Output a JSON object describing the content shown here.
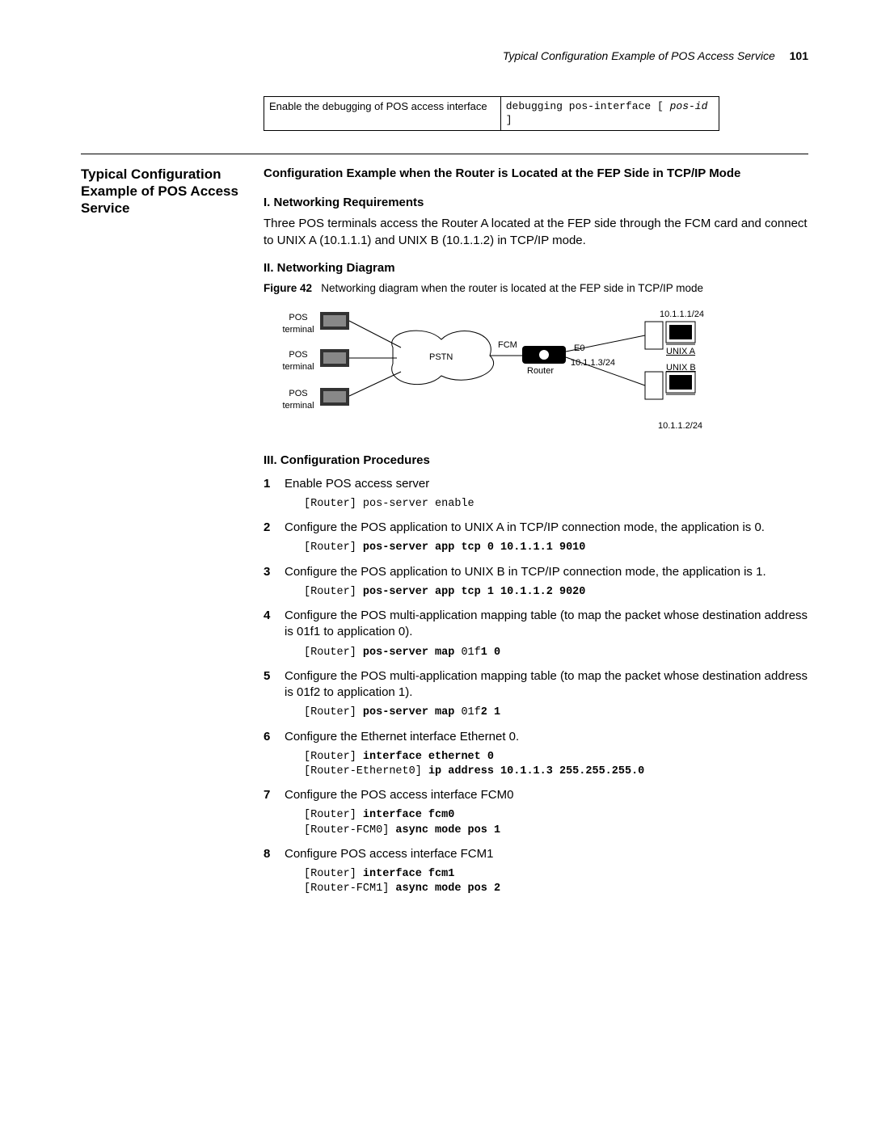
{
  "running_head": {
    "title": "Typical Configuration Example of POS Access Service",
    "page": "101"
  },
  "table": {
    "desc": "Enable the debugging of POS access interface",
    "cmd_lead": "debugging pos-interface [ ",
    "cmd_arg": "pos-id",
    "cmd_trail": " ]"
  },
  "side_head": "Typical Configuration Example of POS Access Service",
  "sec_title": "Configuration Example when the Router is Located at the FEP Side in TCP/IP Mode",
  "h_req": "I. Networking Requirements",
  "req_body": "Three POS terminals access the Router A located at the FEP side through the FCM card and connect to UNIX A (10.1.1.1) and UNIX B (10.1.1.2) in TCP/IP mode.",
  "h_diag": "II. Networking Diagram",
  "figcap_lead": "Figure 42",
  "figcap_body": "Networking diagram when the router is located at the FEP side in TCP/IP mode",
  "diagram": {
    "pos1": "POS terminal",
    "pos2": "POS terminal",
    "pos3": "POS terminal",
    "pstn": "PSTN",
    "fcm": "FCM",
    "router": "Router",
    "e0": "E0",
    "e0_ip": "10.1.1.3/24",
    "unix_a": "UNIX A",
    "unix_a_ip": "10.1.1.1/24",
    "unix_b": "UNIX B",
    "unix_b_ip": "10.1.1.2/24"
  },
  "h_proc": "III. Configuration Procedures",
  "steps": {
    "s1": {
      "text": "Enable POS access server",
      "code": "[Router] pos-server enable"
    },
    "s2": {
      "text": "Configure the POS application to UNIX A in TCP/IP connection mode, the application is 0.",
      "code_pre": "[Router] ",
      "code_b": "pos-server app tcp 0 10.1.1.1 9010"
    },
    "s3": {
      "text": "Configure the POS application to UNIX B in TCP/IP connection mode, the application is 1.",
      "code_pre": "[Router] ",
      "code_b": "pos-server app tcp 1 10.1.1.2 9020"
    },
    "s4": {
      "text": "Configure the POS multi-application mapping table (to map the packet whose destination address is 01f1 to application 0).",
      "code_pre": "[Router] ",
      "code_b": "pos-server map ",
      "code_n": "01f",
      "code_b2": "1 0"
    },
    "s5": {
      "text": "Configure the POS multi-application mapping table (to map the packet whose destination address is 01f2 to application 1).",
      "code_pre": "[Router] ",
      "code_b": "pos-server map ",
      "code_n": "01f",
      "code_b2": "2 1"
    },
    "s6": {
      "text": "Configure the Ethernet interface Ethernet 0.",
      "l1_pre": "[Router] ",
      "l1_b": "interface ethernet 0",
      "l2_pre": "[Router-Ethernet0] ",
      "l2_b": "ip address 10.1.1.3 255.255.255.0"
    },
    "s7": {
      "text": "Configure the POS access interface FCM0",
      "l1_pre": "[Router] ",
      "l1_b": "interface fcm0",
      "l2_pre": "[Router-FCM0] ",
      "l2_b": "async mode pos 1"
    },
    "s8": {
      "text": "Configure POS access interface FCM1",
      "l1_pre": "[Router] ",
      "l1_b": "interface fcm1",
      "l2_pre": "[Router-FCM1] ",
      "l2_b": "async mode pos 2"
    }
  }
}
